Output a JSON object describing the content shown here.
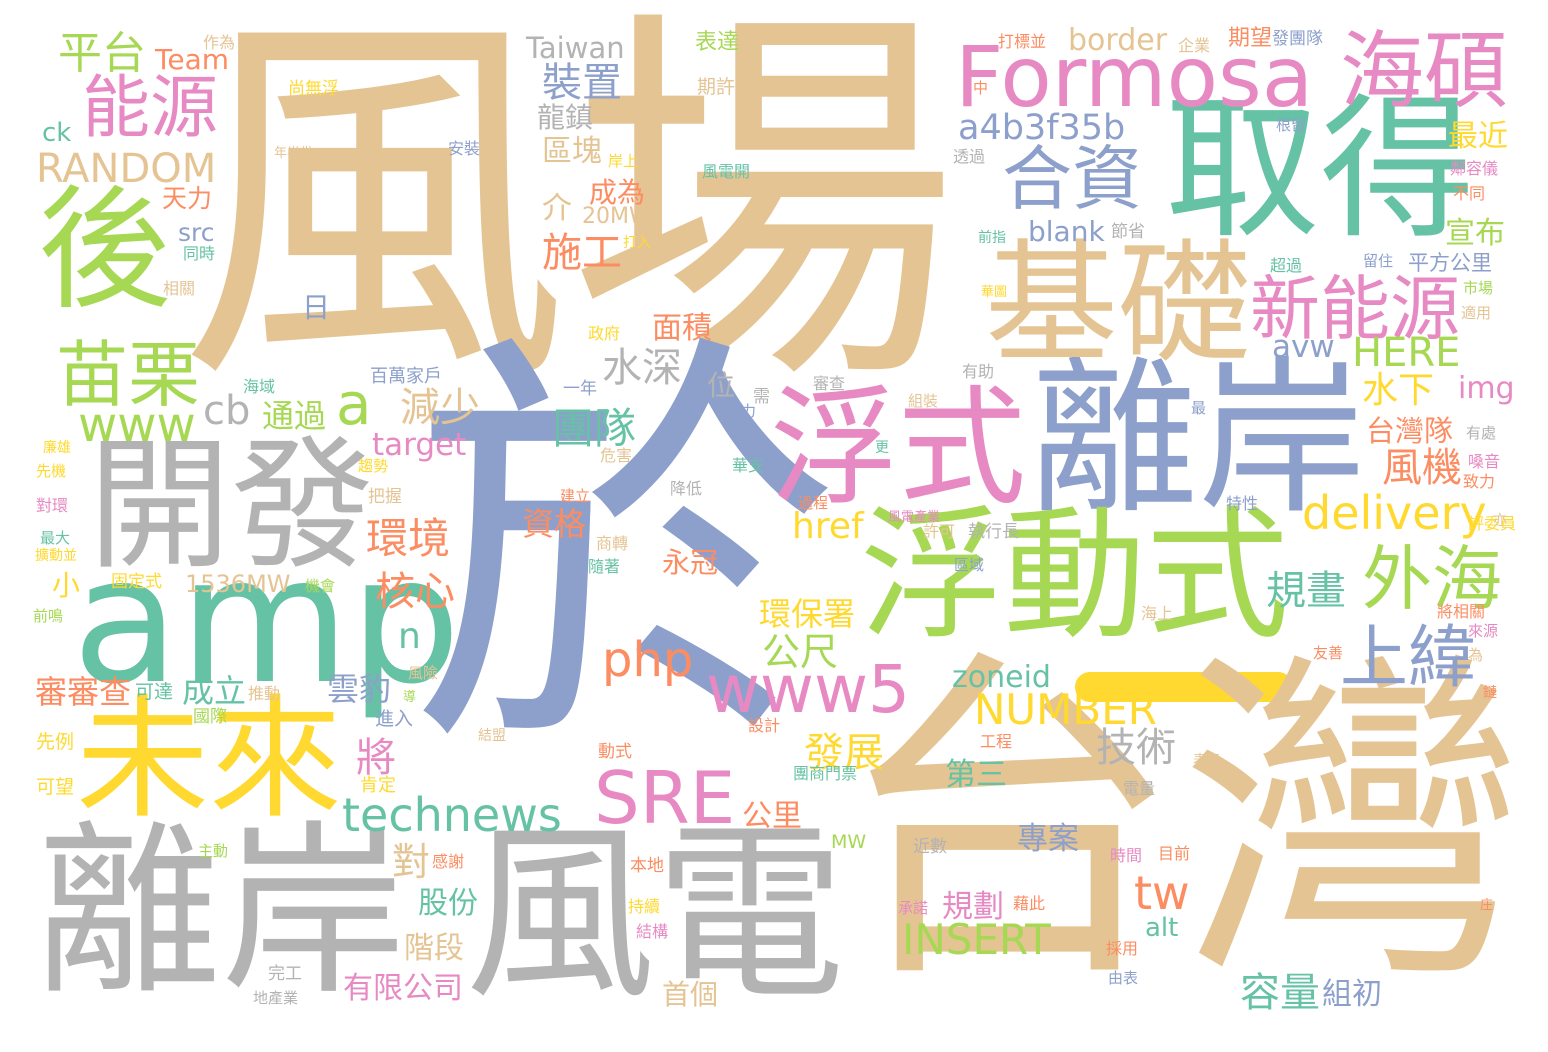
{
  "palette": {
    "tan": "#E5C494",
    "teal": "#66C2A5",
    "blue": "#8DA0CB",
    "pink": "#E78AC3",
    "lime": "#A6D854",
    "yellow": "#FFD92F",
    "orange": "#FC8D62",
    "gray": "#B3B3B3"
  },
  "words": [
    {
      "text": "風場",
      "color": "tan"
    },
    {
      "text": "於",
      "color": "blue"
    },
    {
      "text": "台灣",
      "color": "tan"
    },
    {
      "text": "離岸",
      "color": "blue"
    },
    {
      "text": "取得",
      "color": "teal"
    },
    {
      "text": "基礎",
      "color": "tan"
    },
    {
      "text": "浮式",
      "color": "pink"
    },
    {
      "text": "浮動式",
      "color": "lime"
    },
    {
      "text": "開發",
      "color": "gray"
    },
    {
      "text": "amp",
      "color": "teal"
    },
    {
      "text": "未來",
      "color": "yellow"
    },
    {
      "text": "離岸",
      "color": "gray"
    },
    {
      "text": "風電",
      "color": "gray"
    },
    {
      "text": "後",
      "color": "lime"
    },
    {
      "text": "Formosa",
      "color": "pink"
    },
    {
      "text": "海碩",
      "color": "pink"
    },
    {
      "text": "能源",
      "color": "pink"
    },
    {
      "text": "平台",
      "color": "lime"
    },
    {
      "text": "Team",
      "color": "orange"
    },
    {
      "text": "Taiwan",
      "color": "gray"
    },
    {
      "text": "合資",
      "color": "blue"
    },
    {
      "text": "a4b3f35b",
      "color": "blue"
    },
    {
      "text": "新能源",
      "color": "pink"
    },
    {
      "text": "苗栗",
      "color": "lime"
    },
    {
      "text": "www",
      "color": "lime"
    },
    {
      "text": "a",
      "color": "lime"
    },
    {
      "text": "cb",
      "color": "gray"
    },
    {
      "text": "外海",
      "color": "lime"
    },
    {
      "text": "上緯",
      "color": "blue"
    },
    {
      "text": "www5",
      "color": "pink"
    },
    {
      "text": "SRE",
      "color": "pink"
    },
    {
      "text": "technews",
      "color": "teal"
    },
    {
      "text": "php",
      "color": "orange"
    },
    {
      "text": "RANDOM",
      "color": "tan"
    },
    {
      "text": "delivery",
      "color": "yellow"
    },
    {
      "text": "NUMBER",
      "color": "yellow"
    },
    {
      "text": "INSERT",
      "color": "lime"
    },
    {
      "text": "tw",
      "color": "orange"
    },
    {
      "text": "裝置",
      "color": "blue"
    },
    {
      "text": "施工",
      "color": "orange"
    },
    {
      "text": "水深",
      "color": "gray"
    },
    {
      "text": "團隊",
      "color": "teal"
    },
    {
      "text": "減少",
      "color": "tan"
    },
    {
      "text": "環境",
      "color": "orange"
    },
    {
      "text": "核心",
      "color": "orange"
    },
    {
      "text": "n",
      "color": "teal"
    },
    {
      "text": "將",
      "color": "pink"
    },
    {
      "text": "對",
      "color": "tan"
    },
    {
      "text": "股份",
      "color": "teal"
    },
    {
      "text": "階段",
      "color": "tan"
    },
    {
      "text": "有限公司",
      "color": "pink"
    },
    {
      "text": "技術",
      "color": "gray"
    },
    {
      "text": "發展",
      "color": "yellow"
    },
    {
      "text": "第三",
      "color": "teal"
    },
    {
      "text": "專案",
      "color": "blue"
    },
    {
      "text": "規劃",
      "color": "pink"
    },
    {
      "text": "容量",
      "color": "teal"
    },
    {
      "text": "組初",
      "color": "blue"
    },
    {
      "text": "風機",
      "color": "orange"
    },
    {
      "text": "規畫",
      "color": "teal"
    },
    {
      "text": "台灣隊",
      "color": "orange"
    },
    {
      "text": "水下",
      "color": "yellow"
    },
    {
      "text": "HERE",
      "color": "lime"
    },
    {
      "text": "img",
      "color": "pink"
    },
    {
      "text": "avw",
      "color": "blue"
    },
    {
      "text": "最近",
      "color": "yellow"
    },
    {
      "text": "宣布",
      "color": "lime"
    },
    {
      "text": "平方公里",
      "color": "blue"
    },
    {
      "text": "zoneid",
      "color": "teal"
    },
    {
      "text": "公尺",
      "color": "lime"
    },
    {
      "text": "環保署",
      "color": "yellow"
    },
    {
      "text": "永冠",
      "color": "orange"
    },
    {
      "text": "href",
      "color": "yellow"
    },
    {
      "text": "資格",
      "color": "orange"
    },
    {
      "text": "雲豹",
      "color": "blue"
    },
    {
      "text": "成立",
      "color": "teal"
    },
    {
      "text": "審審查",
      "color": "orange"
    },
    {
      "text": "通過",
      "color": "lime"
    },
    {
      "text": "target",
      "color": "pink"
    },
    {
      "text": "1536MW",
      "color": "tan"
    },
    {
      "text": "小",
      "color": "yellow"
    },
    {
      "text": "border",
      "color": "tan"
    },
    {
      "text": "公里",
      "color": "orange"
    },
    {
      "text": "首個",
      "color": "tan"
    },
    {
      "text": "面積",
      "color": "orange"
    },
    {
      "text": "位",
      "color": "gray"
    },
    {
      "text": "日",
      "color": "blue"
    },
    {
      "text": "src",
      "color": "blue"
    },
    {
      "text": "天力",
      "color": "orange"
    },
    {
      "text": "ck",
      "color": "teal"
    },
    {
      "text": "介",
      "color": "tan"
    },
    {
      "text": "成為",
      "color": "orange"
    },
    {
      "text": "區塊",
      "color": "tan"
    },
    {
      "text": "龍鎮",
      "color": "gray"
    },
    {
      "text": "20MW",
      "color": "tan"
    },
    {
      "text": "blank",
      "color": "blue"
    },
    {
      "text": "alt",
      "color": "teal"
    },
    {
      "text": "表達",
      "color": "lime"
    },
    {
      "text": "期許",
      "color": "tan"
    },
    {
      "text": "期望",
      "color": "orange"
    },
    {
      "text": "作為",
      "color": "tan"
    },
    {
      "text": "尚無浮",
      "color": "yellow"
    },
    {
      "text": "年半供",
      "color": "tan"
    },
    {
      "text": "安裝",
      "color": "blue"
    },
    {
      "text": "同時",
      "color": "teal"
    },
    {
      "text": "相關",
      "color": "tan"
    },
    {
      "text": "打入",
      "color": "yellow"
    },
    {
      "text": "岸上",
      "color": "yellow"
    },
    {
      "text": "風電開",
      "color": "teal"
    },
    {
      "text": "打標並",
      "color": "orange"
    },
    {
      "text": "企業",
      "color": "tan"
    },
    {
      "text": "發團隊",
      "color": "blue"
    },
    {
      "text": "中",
      "color": "orange"
    },
    {
      "text": "透過",
      "color": "gray"
    },
    {
      "text": "根留",
      "color": "blue"
    },
    {
      "text": "節省",
      "color": "gray"
    },
    {
      "text": "不同",
      "color": "orange"
    },
    {
      "text": "鄰容儀",
      "color": "pink"
    },
    {
      "text": "前指",
      "color": "teal"
    },
    {
      "text": "超過",
      "color": "teal"
    },
    {
      "text": "留住",
      "color": "blue"
    },
    {
      "text": "市場",
      "color": "lime"
    },
    {
      "text": "適用",
      "color": "tan"
    },
    {
      "text": "華圖",
      "color": "yellow"
    },
    {
      "text": "政府",
      "color": "yellow"
    },
    {
      "text": "一年",
      "color": "blue"
    },
    {
      "text": "百萬家戶",
      "color": "blue"
    },
    {
      "text": "海域",
      "color": "teal"
    },
    {
      "text": "有助",
      "color": "gray"
    },
    {
      "text": "審查",
      "color": "gray"
    },
    {
      "text": "組裝",
      "color": "tan"
    },
    {
      "text": "需",
      "color": "gray"
    },
    {
      "text": "全力",
      "color": "blue"
    },
    {
      "text": "最",
      "color": "blue"
    },
    {
      "text": "有處",
      "color": "gray"
    },
    {
      "text": "華支",
      "color": "teal"
    },
    {
      "text": "危害",
      "color": "tan"
    },
    {
      "text": "嗓音",
      "color": "pink"
    },
    {
      "text": "致力",
      "color": "orange"
    },
    {
      "text": "更",
      "color": "teal"
    },
    {
      "text": "特性",
      "color": "blue"
    },
    {
      "text": "降低",
      "color": "gray"
    },
    {
      "text": "建立",
      "color": "orange"
    },
    {
      "text": "風電產業",
      "color": "pink"
    },
    {
      "text": "過程",
      "color": "orange"
    },
    {
      "text": "許可",
      "color": "tan"
    },
    {
      "text": "執行長",
      "color": "gray"
    },
    {
      "text": "評委員",
      "color": "yellow"
    },
    {
      "text": "亦",
      "color": "tan"
    },
    {
      "text": "商轉",
      "color": "tan"
    },
    {
      "text": "隨著",
      "color": "teal"
    },
    {
      "text": "區域",
      "color": "blue"
    },
    {
      "text": "海上",
      "color": "tan"
    },
    {
      "text": "將相關",
      "color": "orange"
    },
    {
      "text": "來源",
      "color": "pink"
    },
    {
      "text": "友善",
      "color": "orange"
    },
    {
      "text": "為",
      "color": "tan"
    },
    {
      "text": "鏈",
      "color": "orange"
    },
    {
      "text": "設計",
      "color": "orange"
    },
    {
      "text": "動式",
      "color": "orange"
    },
    {
      "text": "工程",
      "color": "orange"
    },
    {
      "text": "表示",
      "color": "tan"
    },
    {
      "text": "團商門票",
      "color": "teal"
    },
    {
      "text": "電量",
      "color": "gray"
    },
    {
      "text": "近數",
      "color": "gray"
    },
    {
      "text": "MW",
      "color": "lime"
    },
    {
      "text": "時間",
      "color": "pink"
    },
    {
      "text": "目前",
      "color": "orange"
    },
    {
      "text": "本地",
      "color": "orange"
    },
    {
      "text": "持續",
      "color": "yellow"
    },
    {
      "text": "結構",
      "color": "pink"
    },
    {
      "text": "承諾",
      "color": "pink"
    },
    {
      "text": "藉此",
      "color": "orange"
    },
    {
      "text": "採用",
      "color": "orange"
    },
    {
      "text": "由表",
      "color": "blue"
    },
    {
      "text": "完工",
      "color": "gray"
    },
    {
      "text": "地產業",
      "color": "gray"
    },
    {
      "text": "主動",
      "color": "lime"
    },
    {
      "text": "感謝",
      "color": "orange"
    },
    {
      "text": "先例",
      "color": "yellow"
    },
    {
      "text": "可望",
      "color": "yellow"
    },
    {
      "text": "推動",
      "color": "tan"
    },
    {
      "text": "國際",
      "color": "lime"
    },
    {
      "text": "可達",
      "color": "teal"
    },
    {
      "text": "肯定",
      "color": "yellow"
    },
    {
      "text": "進入",
      "color": "blue"
    },
    {
      "text": "結盟",
      "color": "tan"
    },
    {
      "text": "機會",
      "color": "lime"
    },
    {
      "text": "固定式",
      "color": "yellow"
    },
    {
      "text": "前鳴",
      "color": "lime"
    },
    {
      "text": "先機",
      "color": "yellow"
    },
    {
      "text": "對環",
      "color": "pink"
    },
    {
      "text": "最大",
      "color": "teal"
    },
    {
      "text": "擴動並",
      "color": "yellow"
    },
    {
      "text": "趨勢",
      "color": "yellow"
    },
    {
      "text": "把握",
      "color": "tan"
    },
    {
      "text": "廉雄",
      "color": "yellow"
    },
    {
      "text": "風險",
      "color": "tan"
    },
    {
      "text": "導",
      "color": "lime"
    },
    {
      "text": "庄",
      "color": "orange"
    }
  ]
}
